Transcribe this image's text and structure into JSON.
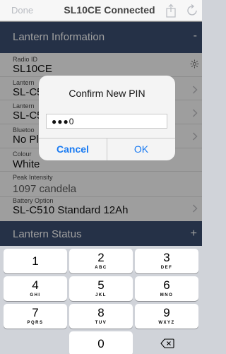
{
  "nav": {
    "done_label": "Done",
    "title": "SL10CE Connected"
  },
  "info_section": {
    "title": "Lantern Information",
    "toggle": "-"
  },
  "fields": [
    {
      "label": "Radio ID",
      "value": "SL10CE"
    },
    {
      "label": "Lantern",
      "value": "SL-C5"
    },
    {
      "label": "Lantern",
      "value": "SL-C5"
    },
    {
      "label": "Bluetoo",
      "value": "No Pl"
    },
    {
      "label": "Colour",
      "value": "White"
    },
    {
      "label": "Peak Intensity",
      "value": "1097 candela"
    },
    {
      "label": "Battery Option",
      "value": "SL-C510 Standard 12Ah"
    }
  ],
  "status_section": {
    "title": "Lantern Status",
    "toggle": "+"
  },
  "alert": {
    "title": "Confirm New PIN",
    "pin_value": "●●●0",
    "cancel_label": "Cancel",
    "ok_label": "OK"
  },
  "keypad": {
    "keys": [
      {
        "digit": "1",
        "letters": ""
      },
      {
        "digit": "2",
        "letters": "ABC"
      },
      {
        "digit": "3",
        "letters": "DEF"
      },
      {
        "digit": "4",
        "letters": "GHI"
      },
      {
        "digit": "5",
        "letters": "JKL"
      },
      {
        "digit": "6",
        "letters": "MNO"
      },
      {
        "digit": "7",
        "letters": "PQRS"
      },
      {
        "digit": "8",
        "letters": "TUV"
      },
      {
        "digit": "9",
        "letters": "WXYZ"
      },
      {
        "digit": "0",
        "letters": ""
      }
    ]
  },
  "icons": {
    "share": "share-icon",
    "refresh": "refresh-icon",
    "brightness": "brightness-icon",
    "chevron": "chevron-right-icon",
    "backspace": "backspace-icon"
  },
  "colors": {
    "header_bg": "#3c4f73",
    "accent": "#1a7bf2",
    "keyboard_bg": "#d0d3d9"
  }
}
